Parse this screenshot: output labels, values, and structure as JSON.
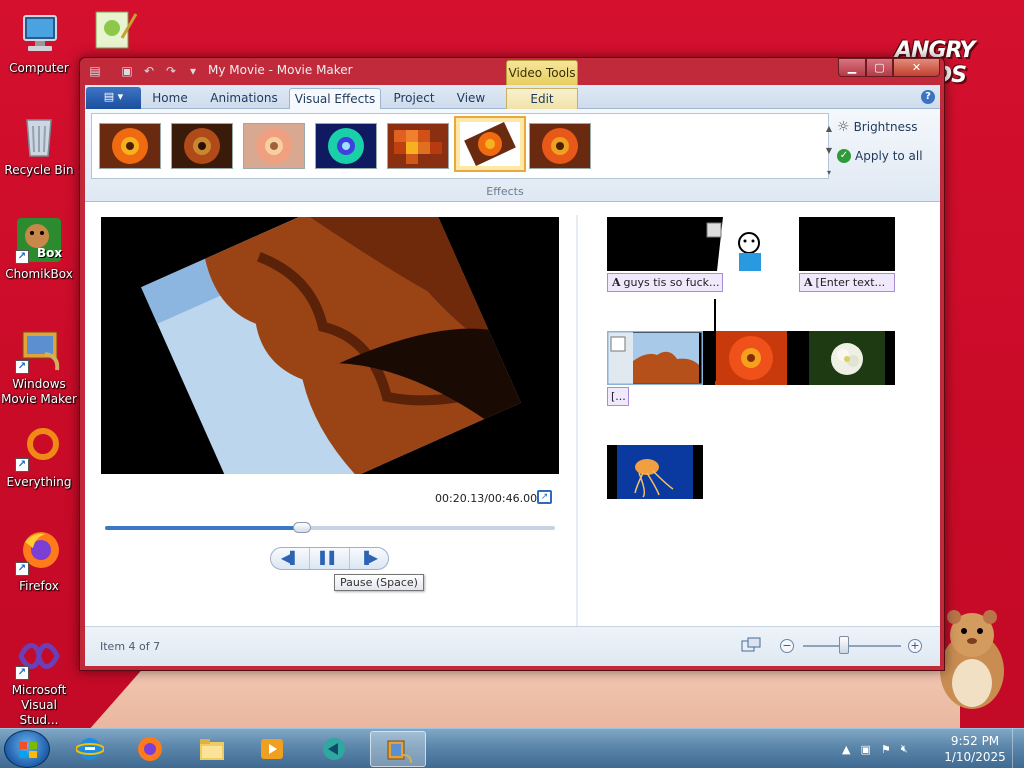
{
  "desktop": {
    "icons": [
      {
        "label": "Computer",
        "icon": "computer-icon"
      },
      {
        "label": "Recycle Bin",
        "icon": "recycle-bin-icon"
      },
      {
        "label": "ChomikBox",
        "icon": "chomikbox-icon"
      },
      {
        "label": "Windows Movie Maker",
        "icon": "movie-maker-icon"
      },
      {
        "label": "Everything",
        "icon": "everything-icon"
      },
      {
        "label": "Firefox",
        "icon": "firefox-icon"
      },
      {
        "label": "Microsoft Visual Stud...",
        "icon": "visual-studio-icon"
      }
    ],
    "logo_text": "ANGRY BIRDS",
    "chomikbox_badge": "Box"
  },
  "window": {
    "title": "My Movie - Movie Maker",
    "contextual_tab": "Video Tools",
    "tabs": [
      "Home",
      "Animations",
      "Visual Effects",
      "Project",
      "View",
      "Edit"
    ],
    "active_tab": "Visual Effects",
    "help": "?"
  },
  "ribbon": {
    "effects_label": "Effects",
    "brightness_label": "Brightness",
    "apply_all_label": "Apply to all",
    "selected_effect_index": 5
  },
  "preview": {
    "timecode": "00:20.13/00:46.00",
    "progress": 0.4376,
    "tooltip": "Pause (Space)"
  },
  "storyboard": {
    "captions": [
      "guys tis so fuck...",
      "[Enter text...",
      "[..."
    ],
    "caption_glyph": "A"
  },
  "status": {
    "item_text": "Item 4 of 7",
    "zoom_minus": "−",
    "zoom_plus": "+"
  },
  "taskbar": {
    "time": "9:52 PM",
    "date": "1/10/2025",
    "items": [
      "internet-explorer-icon",
      "firefox-icon",
      "file-explorer-icon",
      "media-player-icon",
      "app-icon",
      "movie-maker-icon"
    ]
  },
  "colors": {
    "desktop_bg": "#d4102e",
    "window_frame": "#c02a3a",
    "accent_blue": "#3b77c3",
    "caption_bg": "#f0e8fb",
    "selected_effect": "#e7a93a"
  }
}
